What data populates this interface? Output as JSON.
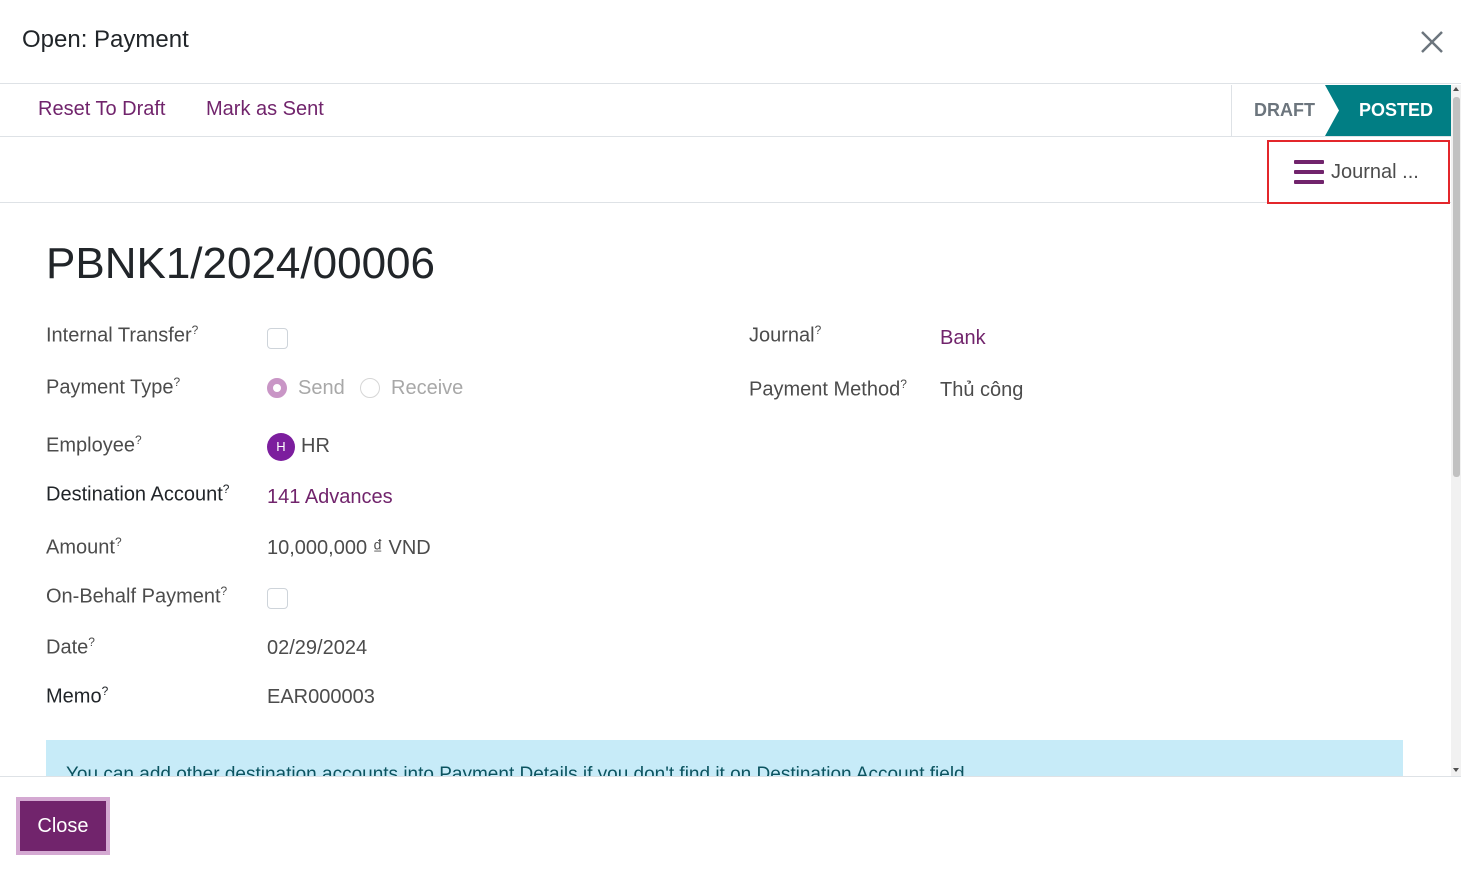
{
  "modal": {
    "title": "Open: Payment"
  },
  "statusbar": {
    "reset_label": "Reset To Draft",
    "mark_sent_label": "Mark as Sent",
    "stages": {
      "draft": "DRAFT",
      "posted": "POSTED"
    },
    "active_stage": "POSTED"
  },
  "button_box": {
    "journal_label": "Journal ..."
  },
  "record": {
    "name": "PBNK1/2024/00006",
    "fields": {
      "internal_transfer": {
        "label": "Internal Transfer",
        "help": "?",
        "checked": false
      },
      "payment_type": {
        "label": "Payment Type",
        "help": "?",
        "options": [
          "Send",
          "Receive"
        ],
        "selected": "Send"
      },
      "employee": {
        "label": "Employee",
        "help": "?",
        "avatar_initial": "H",
        "value": "HR"
      },
      "destination_account": {
        "label": "Destination Account",
        "help": "?",
        "value": "141 Advances"
      },
      "amount": {
        "label": "Amount",
        "help": "?",
        "value": "10,000,000 ₫ VND"
      },
      "on_behalf_payment": {
        "label": "On-Behalf Payment",
        "help": "?",
        "checked": false
      },
      "date": {
        "label": "Date",
        "help": "?",
        "value": "02/29/2024"
      },
      "memo": {
        "label": "Memo",
        "help": "?",
        "value": "EAR000003"
      },
      "journal": {
        "label": "Journal",
        "help": "?",
        "value": "Bank"
      },
      "payment_method": {
        "label": "Payment Method",
        "help": "?",
        "value": "Thủ công"
      }
    },
    "info_alert": "You can add other destination accounts into Payment Details if you don't find it on Destination Account field"
  },
  "footer": {
    "close_label": "Close"
  },
  "colors": {
    "brand": "#71246c",
    "posted_stage": "#017e84",
    "highlight_border": "#e3262b",
    "alert_bg": "#c7ebf8"
  },
  "icons": {
    "close": "close-x-icon",
    "journal": "hamburger-menu-icon"
  }
}
